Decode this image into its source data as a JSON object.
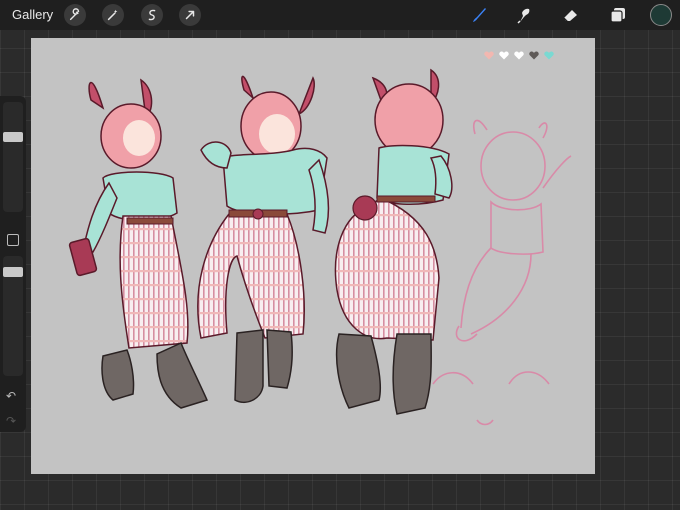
{
  "topbar": {
    "gallery_label": "Gallery",
    "left_tools": [
      "wrench-icon",
      "magic-wand-icon",
      "selection-icon",
      "transform-icon"
    ],
    "right_tools": [
      "brush-icon",
      "smudge-icon",
      "eraser-icon",
      "layers-icon"
    ],
    "active_tool": "brush-icon",
    "current_color": "#1e3a35",
    "brush_color": "#3b82f6"
  },
  "sidebar": {
    "brush_size_level": 0.2,
    "opacity_level": 0.1
  },
  "palette_hearts": [
    "#f2b7b0",
    "#ffffff",
    "#ffffff",
    "#5f5a58",
    "#7ad9d2"
  ],
  "colors": {
    "canvas_bg": "#c3c3c3",
    "hair": "#f0a0a8",
    "shirt": "#a8e3d6",
    "pants_stripe": "#f0b8b8",
    "boots": "#6f6764",
    "sketch": "#d98aa8"
  }
}
